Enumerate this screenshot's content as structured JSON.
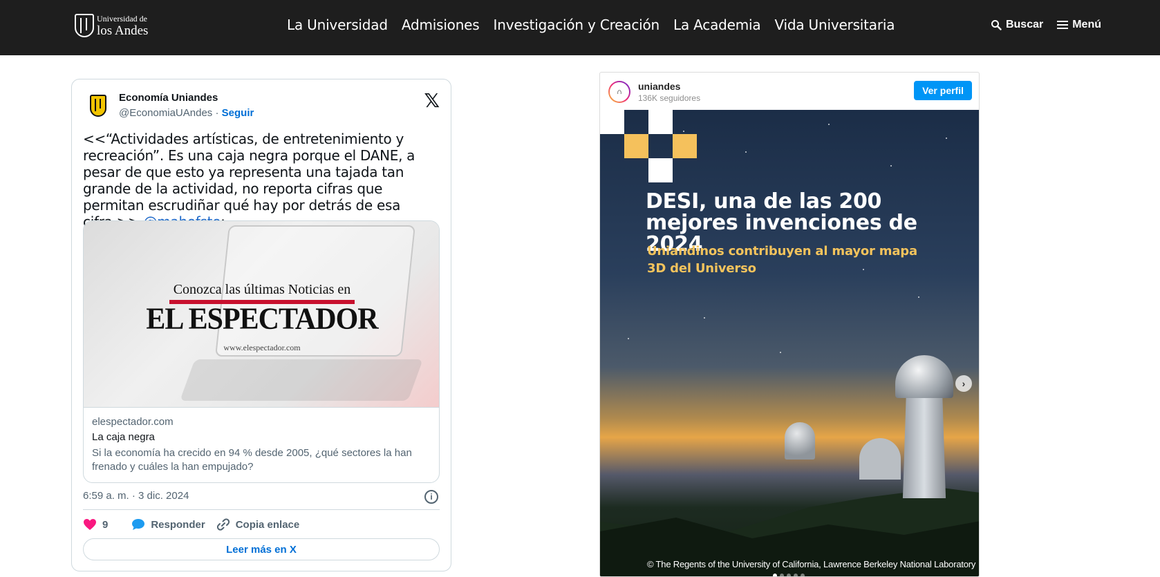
{
  "header": {
    "logo": {
      "line1": "Universidad de",
      "line2": "los Andes"
    },
    "nav": [
      {
        "label": "La Universidad"
      },
      {
        "label": "Admisiones"
      },
      {
        "label": "Investigación y Creación"
      },
      {
        "label": "La Academia"
      },
      {
        "label": "Vida Universitaria"
      }
    ],
    "search_label": "Buscar",
    "menu_label": "Menú"
  },
  "tweet": {
    "author_name": "Economía Uniandes",
    "author_handle": "@EconomiaUAndes",
    "separator": " · ",
    "follow_label": "Seguir",
    "text": "<<“Actividades artísticas, de entretenimiento y recreación”. Es una caja negra porque el DANE, a pesar de que esto ya representa una tajada tan grande de la actividad, no reporta cifras que permitan escrudiñar qué hay por detrás de esa cifra.>> ",
    "mention": "@mahofste",
    "text_end": ":",
    "card": {
      "promo_top": "Conozca las últimas Noticias en",
      "promo_brand": "EL ESPECTADOR",
      "promo_url": "www.elespectador.com",
      "domain": "elespectador.com",
      "title": "La caja negra",
      "description": "Si la economía ha crecido en 94 % desde 2005, ¿qué sectores la han frenado y cuáles la han empujado?"
    },
    "timestamp": "6:59 a. m. · 3 dic. 2024",
    "like_count": "9",
    "reply_label": "Responder",
    "copy_label": "Copia enlace",
    "read_more_label": "Leer más en X",
    "colors": {
      "like": "#f91880",
      "reply": "#1d9bf0",
      "link": "#006fd6"
    }
  },
  "instagram": {
    "username": "uniandes",
    "followers": "136K seguidores",
    "view_profile_label": "Ver perfil",
    "headline": "DESI, una de las 200 mejores invenciones de 2024",
    "subheadline": "Uniandinos contribuyen al mayor mapa 3D del Universo",
    "credit": "© The Regents of the University of California, Lawrence Berkeley National Laboratory",
    "slide_count": 5,
    "active_slide": 1,
    "colors": {
      "button": "#0095f6",
      "headline": "#ffffff",
      "subheadline": "#f3c35c",
      "square_gold": "#f5c15c",
      "square_white": "#ffffff"
    }
  }
}
